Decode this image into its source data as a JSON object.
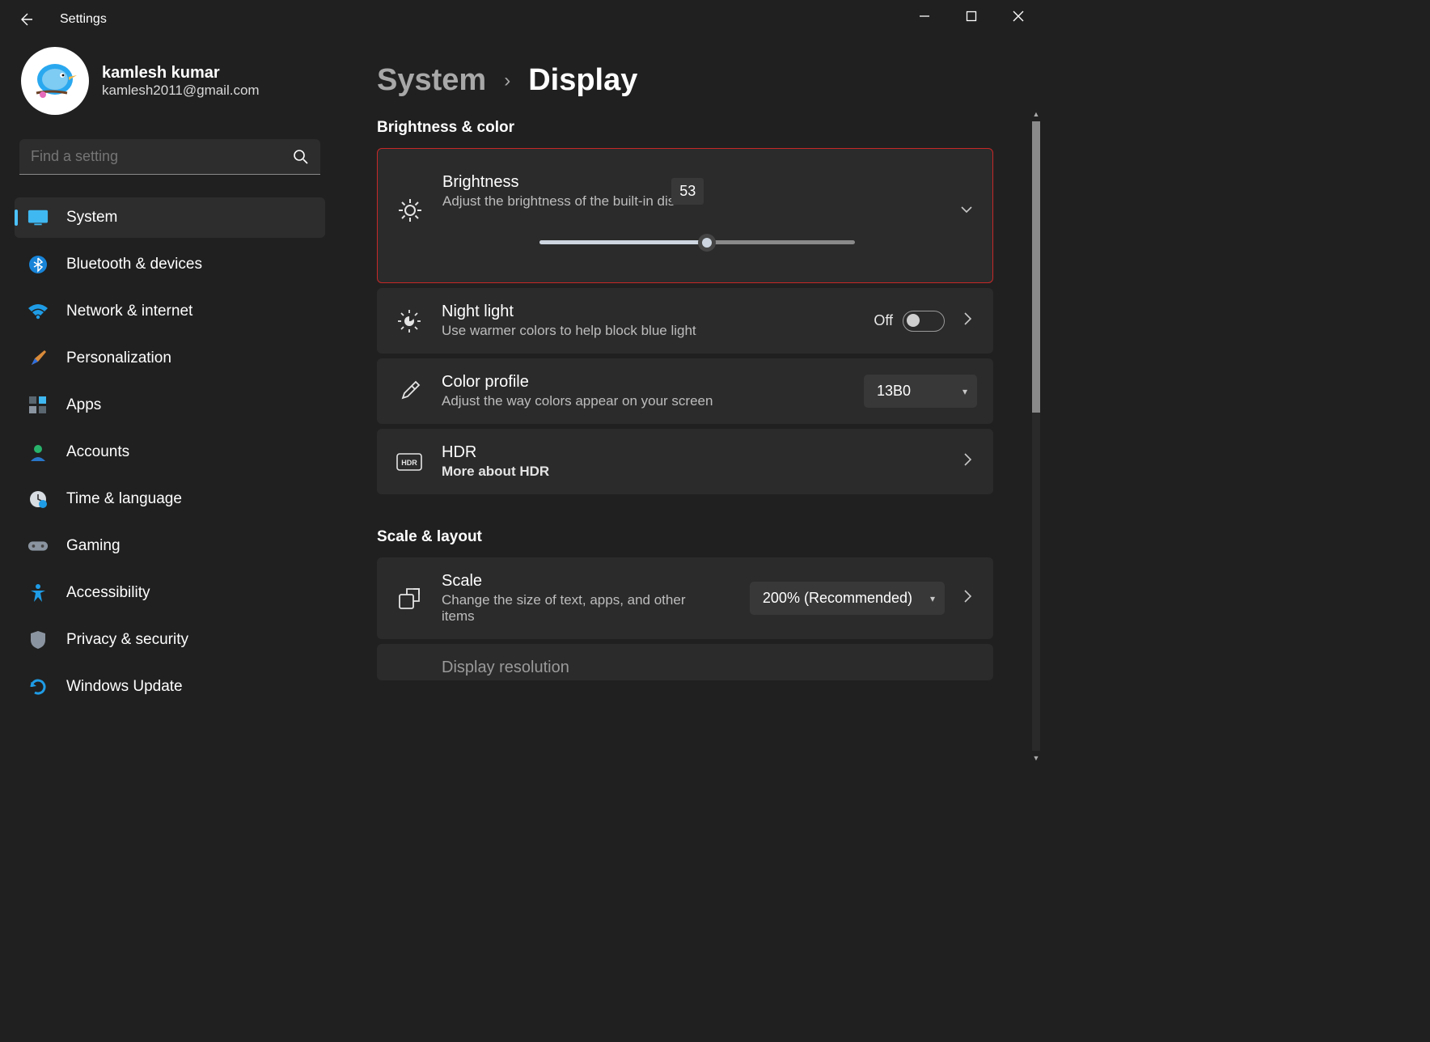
{
  "app": {
    "title": "Settings"
  },
  "user": {
    "name": "kamlesh kumar",
    "email": "kamlesh2011@gmail.com"
  },
  "search": {
    "placeholder": "Find a setting"
  },
  "nav": [
    {
      "label": "System",
      "icon": "monitor",
      "active": true
    },
    {
      "label": "Bluetooth & devices",
      "icon": "bluetooth"
    },
    {
      "label": "Network & internet",
      "icon": "wifi"
    },
    {
      "label": "Personalization",
      "icon": "brush"
    },
    {
      "label": "Apps",
      "icon": "apps"
    },
    {
      "label": "Accounts",
      "icon": "person"
    },
    {
      "label": "Time & language",
      "icon": "clock"
    },
    {
      "label": "Gaming",
      "icon": "gamepad"
    },
    {
      "label": "Accessibility",
      "icon": "accessibility"
    },
    {
      "label": "Privacy & security",
      "icon": "shield"
    },
    {
      "label": "Windows Update",
      "icon": "update"
    }
  ],
  "breadcrumb": {
    "parent": "System",
    "current": "Display"
  },
  "sections": {
    "brightness_color": {
      "title": "Brightness & color",
      "brightness": {
        "title": "Brightness",
        "subtitle": "Adjust the brightness of the built-in dis",
        "value": "53",
        "slider_percent": 53
      },
      "night_light": {
        "title": "Night light",
        "subtitle": "Use warmer colors to help block blue light",
        "toggle_state": "Off"
      },
      "color_profile": {
        "title": "Color profile",
        "subtitle": "Adjust the way colors appear on your screen",
        "selected": "13B0"
      },
      "hdr": {
        "title": "HDR",
        "subtitle": "More about HDR"
      }
    },
    "scale_layout": {
      "title": "Scale & layout",
      "scale": {
        "title": "Scale",
        "subtitle": "Change the size of text, apps, and other items",
        "selected": "200% (Recommended)"
      },
      "display_resolution": {
        "title": "Display resolution"
      }
    }
  }
}
